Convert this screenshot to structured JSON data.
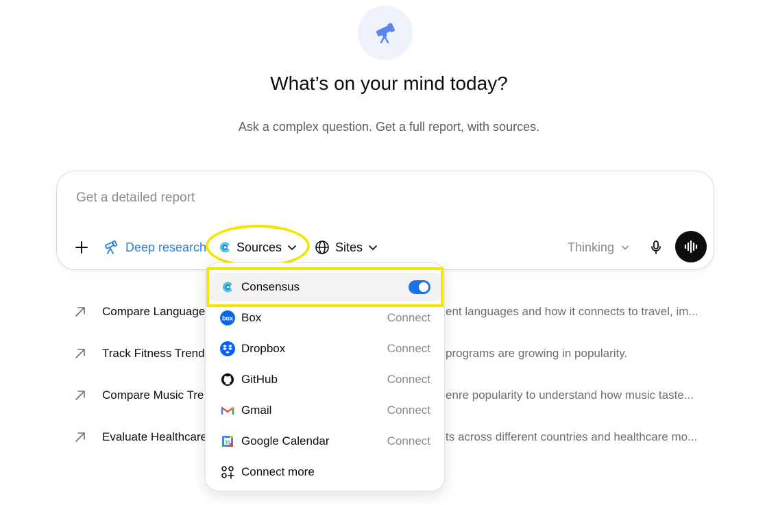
{
  "hero": {
    "icon": "telescope-icon"
  },
  "title": "What’s on your mind today?",
  "subtitle": "Ask a complex question. Get a full report, with sources.",
  "composer": {
    "placeholder": "Get a detailed report",
    "deep_research_label": "Deep research",
    "sources_label": "Sources",
    "sites_label": "Sites",
    "model_label": "Thinking"
  },
  "suggestions": [
    {
      "label": "Compare Language",
      "desc": "ent languages and how it connects to travel, im..."
    },
    {
      "label": "Track Fitness Trends",
      "desc": "programs are growing in popularity."
    },
    {
      "label": "Compare Music Tre",
      "desc": "enre popularity to understand how music taste..."
    },
    {
      "label": "Evaluate Healthcare",
      "desc": "ts across different countries and healthcare mo..."
    }
  ],
  "sources_menu": {
    "items": [
      {
        "name": "Consensus",
        "icon": "consensus-icon",
        "state": "enabled"
      },
      {
        "name": "Box",
        "icon": "box-icon",
        "action": "Connect"
      },
      {
        "name": "Dropbox",
        "icon": "dropbox-icon",
        "action": "Connect"
      },
      {
        "name": "GitHub",
        "icon": "github-icon",
        "action": "Connect"
      },
      {
        "name": "Gmail",
        "icon": "gmail-icon",
        "action": "Connect"
      },
      {
        "name": "Google Calendar",
        "icon": "google-calendar-icon",
        "action": "Connect"
      }
    ],
    "connect_more": "Connect more"
  },
  "colors": {
    "accent": "#2a7fd6",
    "highlight": "#f5e600",
    "toggle_on": "#1a73e8"
  }
}
